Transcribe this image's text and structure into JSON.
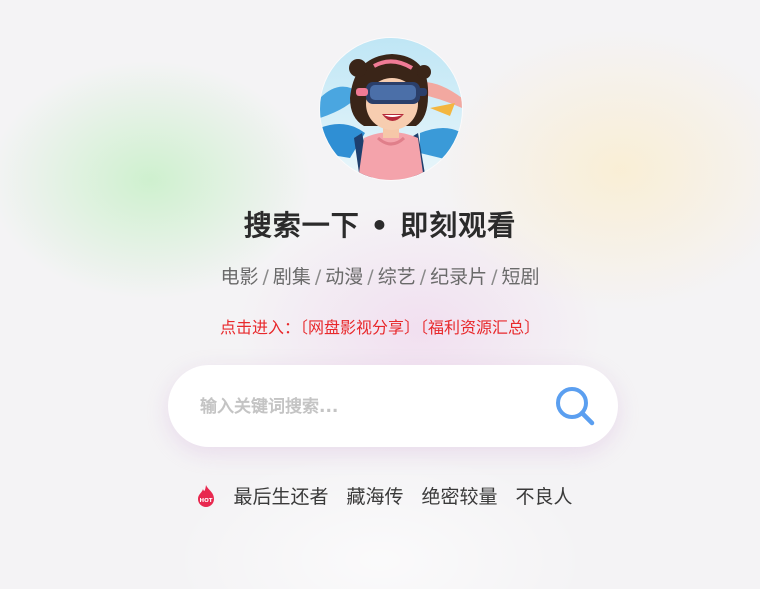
{
  "colors": {
    "accent_red": "#e8282b",
    "search_icon": "#5b9ff0",
    "hot_icon": "#e8284f"
  },
  "header": {
    "avatar_alt": "vr-girl-avatar",
    "title": "搜索一下 • 即刻观看"
  },
  "categories": [
    "电影",
    "剧集",
    "动漫",
    "综艺",
    "纪录片",
    "短剧"
  ],
  "category_separator": "/",
  "promo": {
    "prefix": "点击进入：",
    "link1": "〔网盘影视分享〕",
    "link2": "〔福利资源汇总〕"
  },
  "search": {
    "placeholder": "输入关键词搜索...",
    "value": "",
    "icon": "search-icon"
  },
  "hot": {
    "icon": "hot-fire-icon",
    "badge_text": "HOT",
    "keywords": [
      "最后生还者",
      "藏海传",
      "绝密较量",
      "不良人"
    ]
  }
}
